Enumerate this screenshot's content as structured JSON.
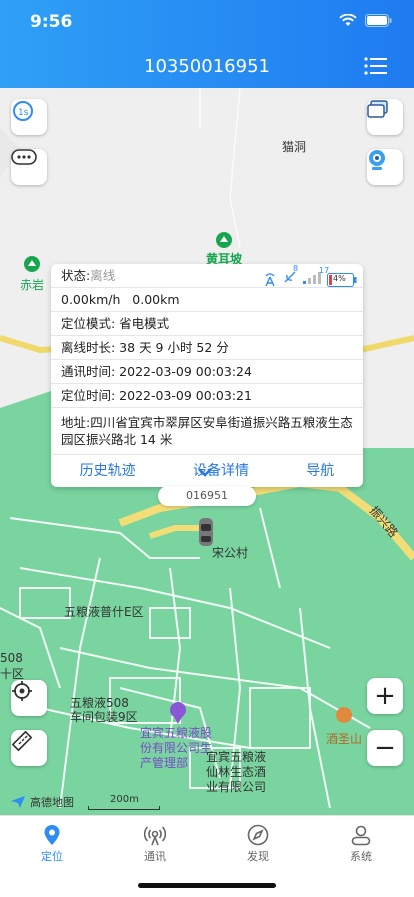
{
  "status": {
    "time": "9:56"
  },
  "header": {
    "title": "10350016951"
  },
  "map": {
    "labels": {
      "maodong": "猫洞",
      "chiyan": "赤岩",
      "huangerpo": "黄耳坡",
      "songgongcun": "宋公村",
      "wuliangye_puE": "五粮液普什E区",
      "workshop": "五粮液508\n车间包装9区",
      "partial_508": "508",
      "partial_shiqu": "十区",
      "company": "宜宾五粮液股\n份有限公司生\n产管理部",
      "forest": "宜宾五粮液\n仙林生态酒\n业有限公司",
      "jiushengshan": "酒圣山",
      "zhenxinglu": "振兴路"
    },
    "brand": "高德地图",
    "scale": "200m"
  },
  "card": {
    "status_label": "状态:",
    "status_value": "离线",
    "battery": "4%",
    "signal_gps": "8",
    "signal_cell": "17",
    "speed_line": "0.00km/h   0.00km",
    "mode": "定位模式: 省电模式",
    "offline": "离线时长: 38 天 9 小时 52 分",
    "comm_time": "通讯时间: 2022-03-09 00:03:24",
    "loc_time": "定位时间: 2022-03-09 00:03:21",
    "address": "地址:四川省宜宾市翠屏区安阜街道振兴路五粮液生态园区振兴路北 14 米",
    "actions": [
      "历史轨迹",
      "设备详情",
      "导航"
    ]
  },
  "device_label": "016951",
  "tabs": [
    "定位",
    "通讯",
    "发现",
    "系统"
  ],
  "colors": {
    "header": "#1e7bf0",
    "accent": "#2779e6",
    "green": "#73d39c"
  }
}
